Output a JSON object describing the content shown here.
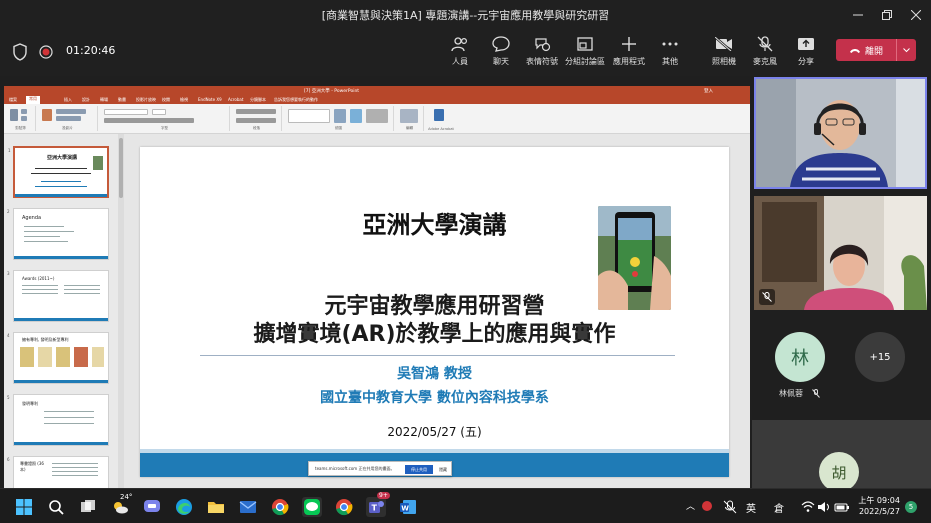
{
  "window": {
    "title": "[商業智慧與決策1A] 專題演講--元宇宙應用教學與研究研習"
  },
  "meeting": {
    "timer": "01:20:46",
    "controls": [
      {
        "key": "people",
        "label": "人員"
      },
      {
        "key": "chat",
        "label": "聊天"
      },
      {
        "key": "reactions",
        "label": "表情符號"
      },
      {
        "key": "rooms",
        "label": "分組討論區"
      },
      {
        "key": "apps",
        "label": "應用程式"
      },
      {
        "key": "more",
        "label": "其他"
      },
      {
        "key": "camera",
        "label": "照相機"
      },
      {
        "key": "mic",
        "label": "麥克風"
      },
      {
        "key": "share",
        "label": "分享"
      }
    ],
    "leave_label": "離開"
  },
  "powerpoint": {
    "title_bar": "[7] 亞洲大學 - PowerPoint",
    "search_hint": "告訴我您想要執行的動作",
    "user": "登入",
    "tabs": [
      "檔案",
      "常用",
      "插入",
      "設計",
      "轉場",
      "動畫",
      "投影片放映",
      "校閱",
      "檢視",
      "EndNote X9",
      "Acrobat",
      "分鏡腳本"
    ],
    "ribbon_groups": [
      "剪貼簿",
      "投影片",
      "字型",
      "段落",
      "繪圖",
      "編輯",
      "Adobe Acrobat"
    ],
    "thumbnails": [
      {
        "num": "1",
        "title": "亞洲大學演講"
      },
      {
        "num": "2",
        "title": "Agenda"
      },
      {
        "num": "3",
        "title": "Awards (2011~)"
      },
      {
        "num": "4",
        "title": "擁有專利, 發明及新型專利"
      },
      {
        "num": "5",
        "title": "發明專利"
      },
      {
        "num": "6",
        "title": "專書證照 (36本)"
      }
    ],
    "notification": {
      "text": "teams.microsoft.com 正在共用您的畫面。",
      "stop_label": "停止共用",
      "hide_label": "隱藏"
    }
  },
  "slide": {
    "heading": "亞洲大學演講",
    "subtitle_line1": "元宇宙教學應用研習營",
    "subtitle_line2": "擴增實境(AR)於教學上的應用與實作",
    "presenter": "吳智鴻 教授",
    "affiliation": "國立臺中教育大學 數位內容科技學系",
    "date": "2022/05/27 (五)"
  },
  "participants": {
    "avatar_initial": "林",
    "avatar_name": "林佩蓉",
    "more_count": "+15",
    "bottom_initial": "胡"
  },
  "taskbar": {
    "weather_temp": "24°",
    "teams_badge": "9+",
    "ime": "英",
    "ime2": "倉",
    "time": "上午 09:04",
    "date": "2022/5/27",
    "notifications": "5"
  },
  "colors": {
    "leave": "#c4314b",
    "ppt_red": "#b7472a",
    "slide_blue": "#1f7bb6",
    "active_border": "#7b83eb"
  }
}
